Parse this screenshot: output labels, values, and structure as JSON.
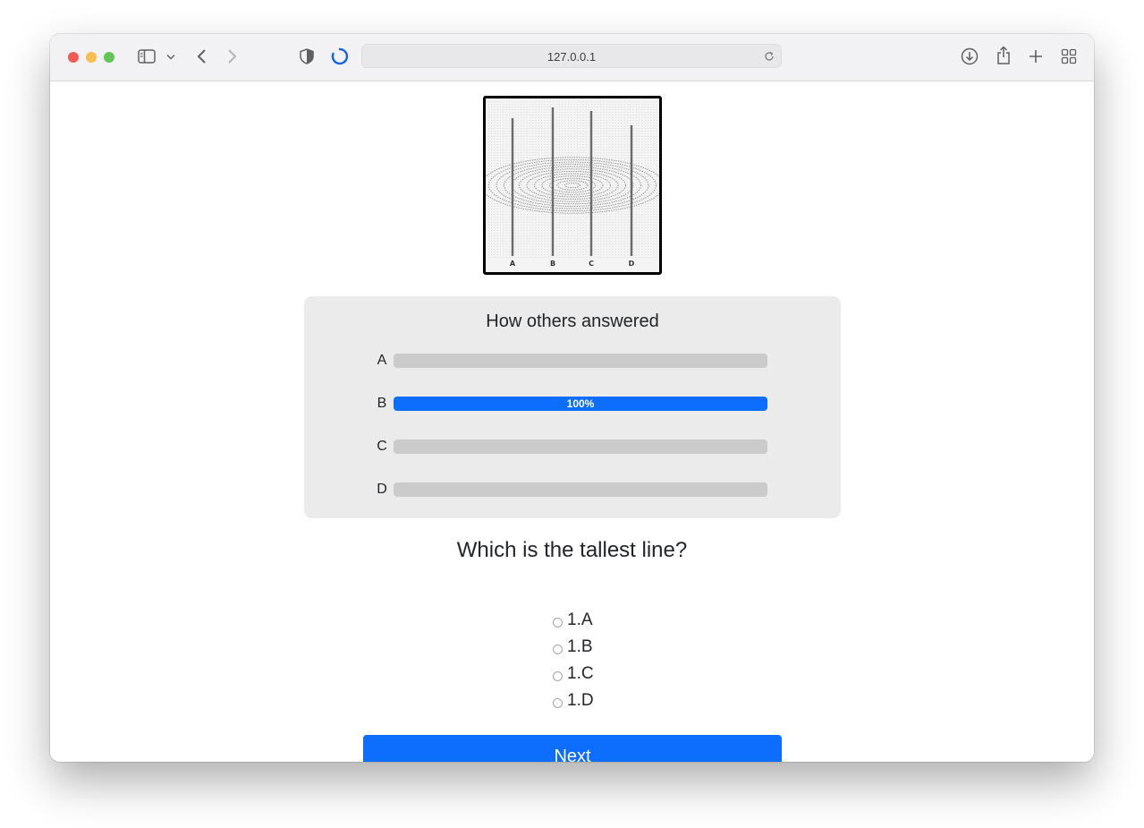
{
  "browser": {
    "url": "127.0.0.1",
    "traffic_colors": [
      "#ee5c54",
      "#f6be4f",
      "#61c454"
    ]
  },
  "stimulus": {
    "line_labels": [
      "A",
      "B",
      "C",
      "D"
    ]
  },
  "results": {
    "title": "How others answered",
    "rows": [
      {
        "label": "A",
        "fraction": 0,
        "text": ""
      },
      {
        "label": "B",
        "fraction": 1,
        "text": "100%"
      },
      {
        "label": "C",
        "fraction": 0,
        "text": ""
      },
      {
        "label": "D",
        "fraction": 0,
        "text": ""
      }
    ],
    "bar_color": "#0d6efd"
  },
  "question": {
    "text": "Which is the tallest line?",
    "options": [
      "1.A",
      "1.B",
      "1.C",
      "1.D"
    ]
  },
  "next_label": "Next"
}
